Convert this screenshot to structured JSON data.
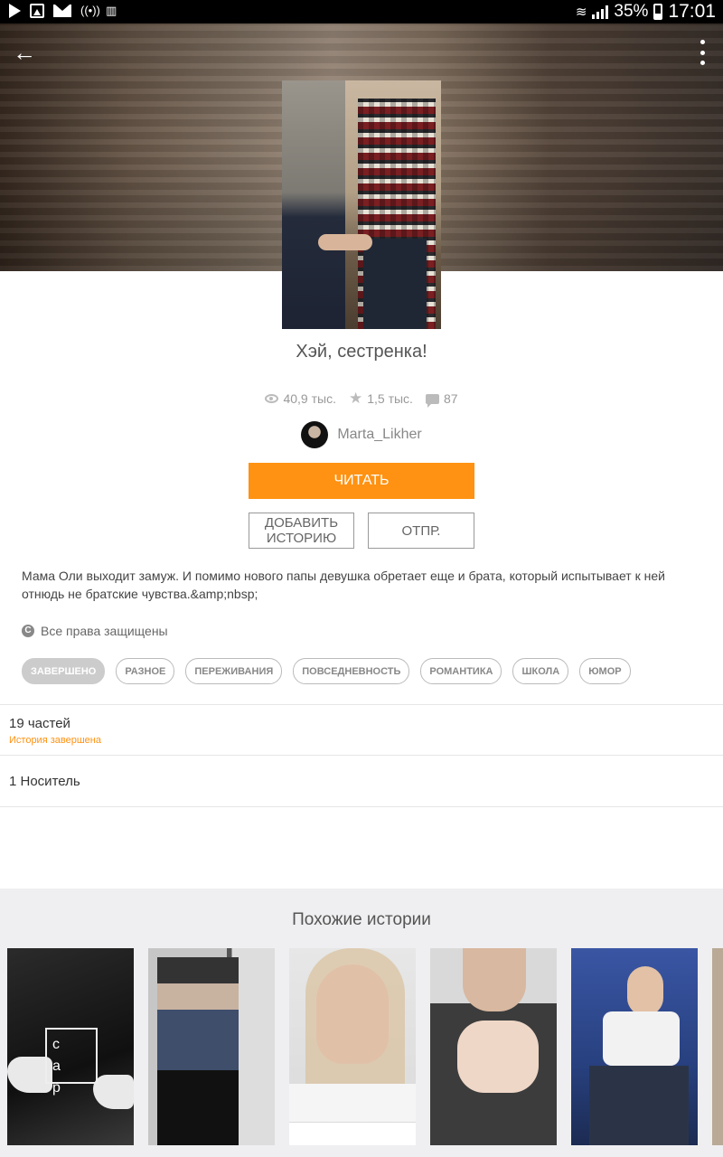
{
  "status_bar": {
    "battery": "35%",
    "time": "17:01"
  },
  "story": {
    "title": "Хэй, сестренка!",
    "views": "40,9 тыс.",
    "votes": "1,5 тыс.",
    "comments": "87",
    "author": "Marta_Likher",
    "read_label": "ЧИТАТЬ",
    "add_label": "ДОБАВИТЬ ИСТОРИЮ",
    "send_label": "ОТПР.",
    "description": "Мама Оли выходит замуж. И помимо нового папы девушка обретает еще и брата, который испытывает к ней отнюдь не братские чувства.&amp;nbsp;",
    "copyright": "Все права защищены"
  },
  "tags": [
    "ЗАВЕРШЕНО",
    "РАЗНОЕ",
    "ПЕРЕЖИВАНИЯ",
    "ПОВСЕДНЕВНОСТЬ",
    "РОМАНТИКА",
    "ШКОЛА",
    "ЮМОР"
  ],
  "parts": {
    "count_label": "19 частей",
    "status_label": "История завершена"
  },
  "reading_lists": {
    "label": "1 Носитель"
  },
  "similar": {
    "title": "Похожие истории",
    "thumb1_text": "c a p"
  },
  "colors": {
    "accent": "#ff9212",
    "similar_bg": "#efeff1"
  },
  "icons": [
    "back-arrow-icon",
    "overflow-menu-icon",
    "eye-icon",
    "star-icon",
    "comment-icon",
    "copyright-icon"
  ]
}
